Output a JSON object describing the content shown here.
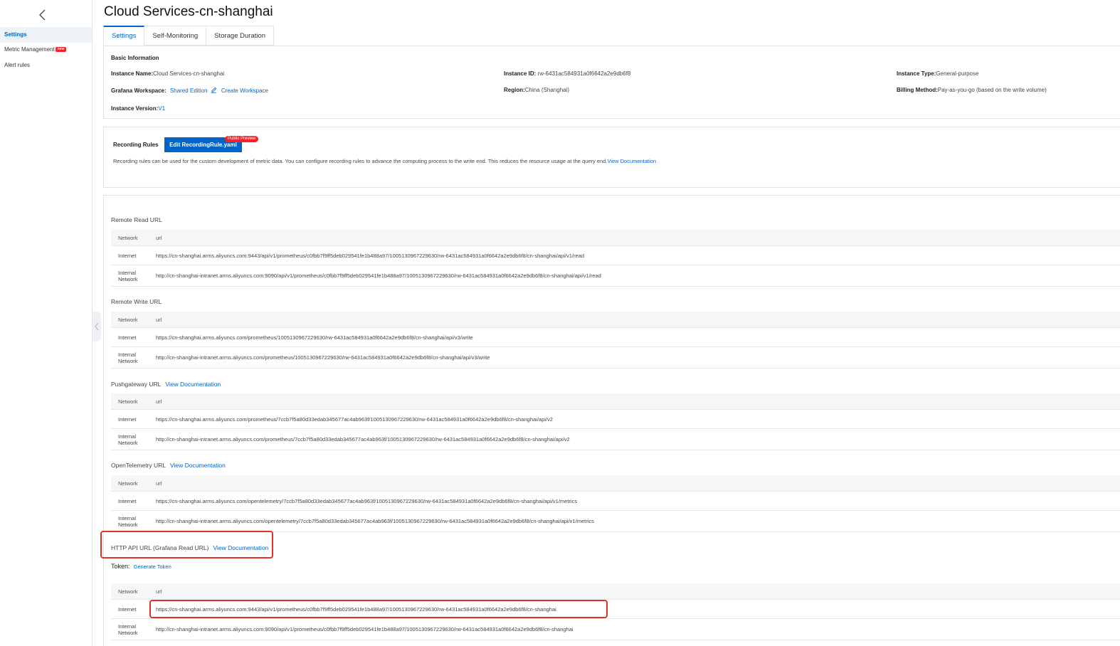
{
  "sidebar": {
    "back_icon": "chevron-left-icon",
    "items": [
      {
        "label": "Settings",
        "active": true
      },
      {
        "label": "Metric Management",
        "badge": "new"
      },
      {
        "label": "Alert rules"
      }
    ]
  },
  "page": {
    "title": "Cloud Services-cn-shanghai",
    "tabs": [
      {
        "label": "Settings",
        "active": true
      },
      {
        "label": "Self-Monitoring"
      },
      {
        "label": "Storage Duration"
      }
    ]
  },
  "basic": {
    "heading": "Basic Information",
    "instance_name_label": "Instance Name:",
    "instance_name": "Cloud Services-cn-shanghai",
    "instance_id_label": "Instance ID:",
    "instance_id": "rw-6431ac584931a0f6642a2e9db6f8",
    "instance_type_label": "Instance Type:",
    "instance_type": "General-purpose",
    "grafana_label": "Grafana Workspace:",
    "grafana_value": "Shared Edition",
    "create_workspace": "Create Workspace",
    "region_label": "Region:",
    "region": "China (Shanghai)",
    "billing_label": "Billing Method:",
    "billing": "Pay-as-you-go (based on the write volume)",
    "version_label": "Instance Version:",
    "version": "V1"
  },
  "recording": {
    "title": "Recording Rules",
    "button": "Edit RecordingRule.yaml",
    "badge": "Public Preview",
    "description": "Recording rules can be used for the custom development of metric data. You can configure recording rules to advance the computing process to the write end. This reduces the resource usage at the query end.",
    "doc_link": "View Documentation"
  },
  "urls": {
    "col_network": "Network",
    "col_url": "url",
    "internet": "Internet",
    "internal": "Internal Network",
    "view_doc": "View Documentation",
    "remote_read": {
      "title": "Remote Read URL",
      "internet_url": "https://cn-shanghai.arms.aliyuncs.com:9443/api/v1/prometheus/c0fbb7f9ff5deb029541fe1b488a97/1005130967229630/rw-6431ac584931a0f6642a2e9db6f8/cn-shanghai/api/v1/read",
      "internal_url": "http://cn-shanghai-intranet.arms.aliyuncs.com:9090/api/v1/prometheus/c0fbb7f9ff5deb029541fe1b488a97/1005130967229630/rw-6431ac584931a0f6642a2e9db6f8/cn-shanghai/api/v1/read"
    },
    "remote_write": {
      "title": "Remote Write URL",
      "internet_url": "https://cn-shanghai.arms.aliyuncs.com/prometheus/1005130967229630/rw-6431ac584931a0f6642a2e9db6f8/cn-shanghai/api/v3/write",
      "internal_url": "http://cn-shanghai-intranet.arms.aliyuncs.com/prometheus/1005130967229630/rw-6431ac584931a0f6642a2e9db6f8/cn-shanghai/api/v3/write"
    },
    "pushgateway": {
      "title": "Pushgateway URL",
      "internet_url": "https://cn-shanghai.arms.aliyuncs.com/prometheus/7ccb7f5a80d33edab345677ac4ab963f/1005130967229630/rw-6431ac584931a0f6642a2e9db6f8/cn-shanghai/api/v2",
      "internal_url": "http://cn-shanghai-intranet.arms.aliyuncs.com/prometheus/7ccb7f5a80d33edab345677ac4ab963f/1005130967229630/rw-6431ac584931a0f6642a2e9db6f8/cn-shanghai/api/v2"
    },
    "opentelemetry": {
      "title": "OpenTelemetry URL",
      "internet_url": "https://cn-shanghai.arms.aliyuncs.com/opentelemetry/7ccb7f5a80d33edab345677ac4ab963f/1005130967229630/rw-6431ac584931a0f6642a2e9db6f8/cn-shanghai/api/v1/metrics",
      "internal_url": "http://cn-shanghai-intranet.arms.aliyuncs.com/opentelemetry/7ccb7f5a80d33edab345677ac4ab963f/1005130967229630/rw-6431ac584931a0f6642a2e9db6f8/cn-shanghai/api/v1/metrics"
    },
    "http_api": {
      "title": "HTTP API URL (Grafana Read URL)",
      "token_label": "Token:",
      "generate_token": "Generate Token",
      "internet_url": "https://cn-shanghai.arms.aliyuncs.com:9443/api/v1/prometheus/c0fbb7f9ff5deb029541fe1b488a97/1005130967229630/rw-6431ac584931a0f6642a2e9db6f8/cn-shanghai",
      "internal_url": "http://cn-shanghai-intranet.arms.aliyuncs.com:9090/api/v1/prometheus/c0fbb7f9ff5deb029541fe1b488a97/1005130967229630/rw-6431ac584931a0f6642a2e9db6f8/cn-shanghai"
    }
  },
  "colors": {
    "accent": "#0064c8",
    "highlight": "#e0322b",
    "badge": "#f5222d"
  }
}
